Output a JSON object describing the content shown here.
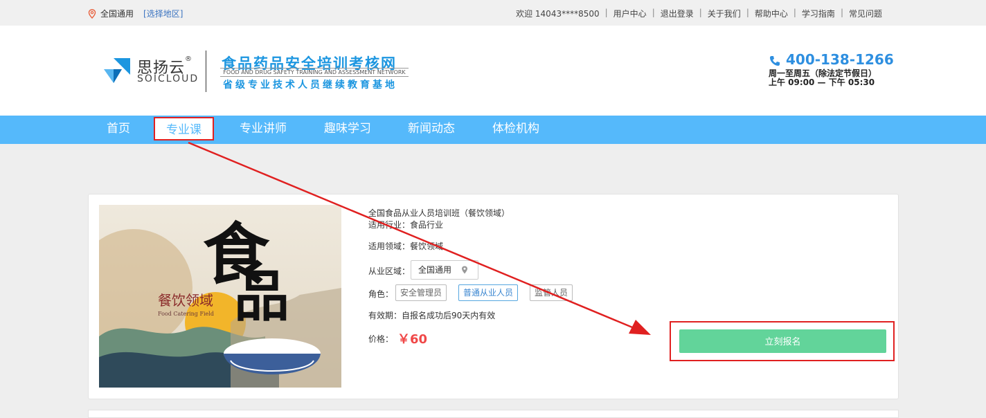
{
  "topbar": {
    "location": "全国通用",
    "select_region": "[选择地区]",
    "welcome": "欢迎 14043****8500",
    "links": [
      "用户中心",
      "退出登录",
      "关于我们",
      "帮助中心",
      "学习指南",
      "常见问题"
    ]
  },
  "header": {
    "logo_cn": "思扬云",
    "logo_reg": "®",
    "logo_en": "SOICLOUD",
    "site_title": "食品药品安全培训考核网",
    "site_en": "FOOD AND DRUG SAFETY TRAINING AND ASSESSMENT NETWORK",
    "site_sub": "省级专业技术人员继续教育基地",
    "phone": "400-138-1266",
    "hours_line1": "周一至周五（除法定节假日）",
    "hours_line2": "上午 09:00 — 下午 05:30"
  },
  "nav": {
    "items": [
      "首页",
      "专业课",
      "专业讲师",
      "趣味学习",
      "新闻动态",
      "体检机构"
    ],
    "active_index": 1
  },
  "course": {
    "image_text_big1": "食",
    "image_text_big2": "品",
    "image_text_cn": "餐饮领域",
    "image_text_en": "Food Catering Field",
    "title": "全国食品从业人员培训班（餐饮领域）",
    "industry_label": "适用行业：",
    "industry_value": "食品行业",
    "field_label": "适用领域：",
    "field_value": "餐饮领域",
    "region_label": "从业区域：",
    "region_value": "全国通用",
    "role_label": "角色：",
    "roles": [
      "安全管理员",
      "普通从业人员",
      "监管人员"
    ],
    "selected_role_index": 1,
    "validity": "有效期：自报名成功后90天内有效",
    "price_label": "价格：",
    "price_value": "￥60",
    "signup_button": "立刻报名"
  },
  "colors": {
    "nav_bg": "#55b9fb",
    "brand_blue": "#1c96e0",
    "price_red": "#f04848",
    "signup_green": "#62d49a",
    "highlight_red": "#e02020"
  }
}
